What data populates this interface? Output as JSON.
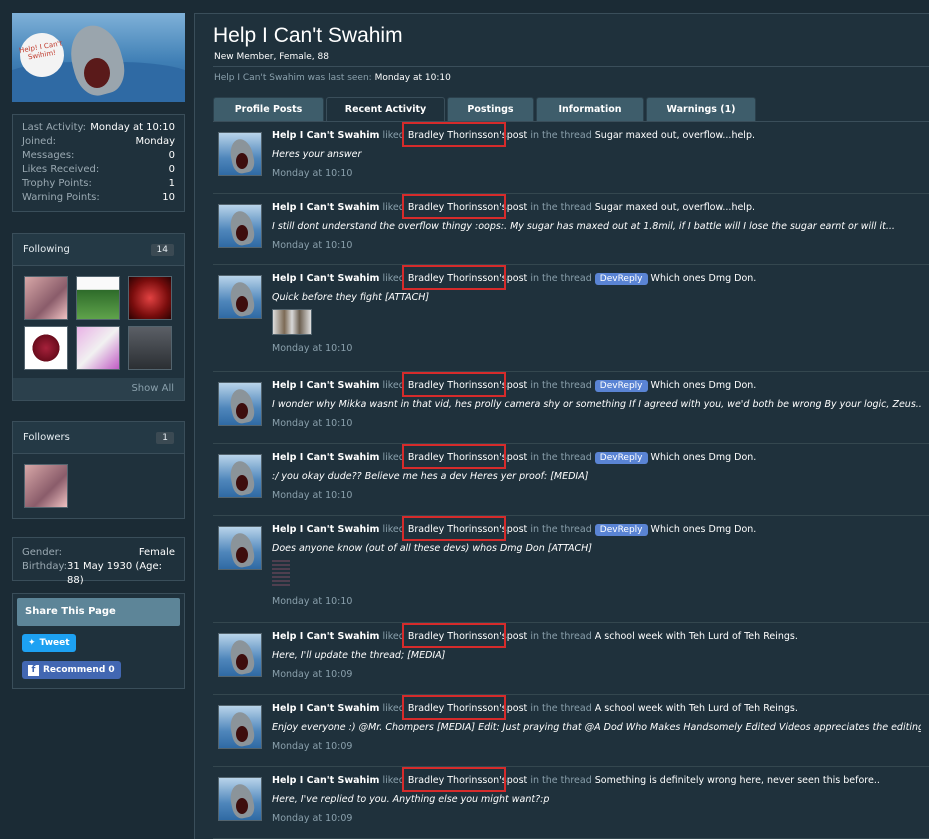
{
  "sidebar": {
    "avatar_text": "Help! I Can't Swihim!",
    "stats": [
      {
        "k": "Last Activity:",
        "v": "Monday at 10:10"
      },
      {
        "k": "Joined:",
        "v": "Monday"
      },
      {
        "k": "Messages:",
        "v": "0"
      },
      {
        "k": "Likes Received:",
        "v": "0"
      },
      {
        "k": "Trophy Points:",
        "v": "1"
      },
      {
        "k": "Warning Points:",
        "v": "10"
      }
    ],
    "following": {
      "label": "Following",
      "count": "14",
      "show_all": "Show All"
    },
    "followers": {
      "label": "Followers",
      "count": "1"
    },
    "details": [
      {
        "k": "Gender:",
        "v": "Female"
      },
      {
        "k": "Birthday:",
        "v": "31 May 1930 (Age: 88)"
      }
    ],
    "share": {
      "label": "Share This Page",
      "tweet": "Tweet",
      "recommend": "Recommend 0"
    }
  },
  "profile": {
    "name": "Help I Can't Swahim",
    "subtitle": "New Member, Female, 88",
    "last_seen_prefix": "Help I Can't Swahim was last seen:",
    "last_seen_value": "Monday at 10:10"
  },
  "tabs": [
    "Profile Posts",
    "Recent Activity",
    "Postings",
    "Information",
    "Warnings (1)"
  ],
  "feed_words": {
    "user": "Help I Can't Swahim",
    "liked": "liked",
    "author": "Bradley Thorinsson's",
    "post": "post",
    "in_thread": "in the thread",
    "prefix": "DevReply"
  },
  "feed": [
    {
      "thread": "Sugar maxed out, overflow...help.",
      "prefix": false,
      "snippet": "Heres your answer",
      "time": "Monday at 10:10"
    },
    {
      "thread": "Sugar maxed out, overflow...help.",
      "prefix": false,
      "snippet": "I still dont understand the overflow thingy :oops:. My sugar has maxed out at 1.8mil, if I battle will I lose the sugar earnt or will it...",
      "time": "Monday at 10:10"
    },
    {
      "thread": "Which ones Dmg Don.",
      "prefix": true,
      "snippet": "Quick before they fight [ATTACH]",
      "time": "Monday at 10:10"
    },
    {
      "thread": "Which ones Dmg Don.",
      "prefix": true,
      "snippet": "I wonder why Mikka wasnt in that vid, hes prolly camera shy or something If I agreed with you, we'd both be wrong By your logic, Zeus...",
      "time": "Monday at 10:10"
    },
    {
      "thread": "Which ones Dmg Don.",
      "prefix": true,
      "snippet": ":/ you okay dude?? Believe me hes a dev Heres yer proof: [MEDIA]",
      "time": "Monday at 10:10"
    },
    {
      "thread": "Which ones Dmg Don.",
      "prefix": true,
      "snippet": "Does anyone know (out of all these devs) whos Dmg Don [ATTACH]",
      "time": "Monday at 10:10"
    },
    {
      "thread": "A school week with Teh Lurd of Teh Reings.",
      "prefix": false,
      "snippet": "Here, I'll update the thread; [MEDIA]",
      "time": "Monday at 10:09"
    },
    {
      "thread": "A school week with Teh Lurd of Teh Reings.",
      "prefix": false,
      "snippet": "Enjoy everyone :) @Mr. Chompers [MEDIA] Edit: Just praying that @A Dod Who Makes Handsomely Edited Videos appreciates the editing.",
      "time": "Monday at 10:09"
    },
    {
      "thread": "Something is definitely wrong here, never seen this before..",
      "prefix": false,
      "snippet": "Here, I've replied to you. Anything else you might want?:p",
      "time": "Monday at 10:09"
    }
  ]
}
